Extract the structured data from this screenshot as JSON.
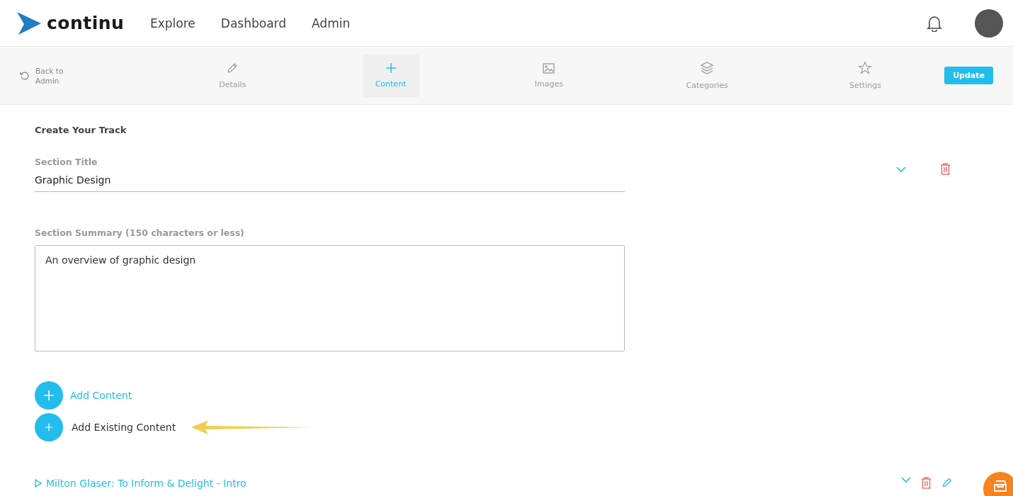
{
  "header": {
    "logo": "continu",
    "nav": [
      {
        "label": "Explore"
      },
      {
        "label": "Dashboard"
      },
      {
        "label": "Admin"
      }
    ]
  },
  "toolbar": {
    "back": "Back to Admin",
    "tabs": [
      {
        "label": "Details",
        "selected": false
      },
      {
        "label": "Content",
        "selected": true
      },
      {
        "label": "Images",
        "selected": false
      },
      {
        "label": "Categories",
        "selected": false
      },
      {
        "label": "Settings",
        "selected": false
      }
    ],
    "update": "Update"
  },
  "form": {
    "heading": "Create Your Track",
    "title_label": "Section Title",
    "title_value": "Graphic Design",
    "summary_label": "Section Summary (150 characters or less)",
    "summary_value": "An overview of graphic design"
  },
  "actions": [
    {
      "label": "Add Content",
      "kind": "link"
    },
    {
      "label": "Add Existing Content",
      "kind": "plain"
    }
  ],
  "content_items": [
    {
      "title": "Milton Glaser: To Inform & Delight - Intro"
    }
  ]
}
